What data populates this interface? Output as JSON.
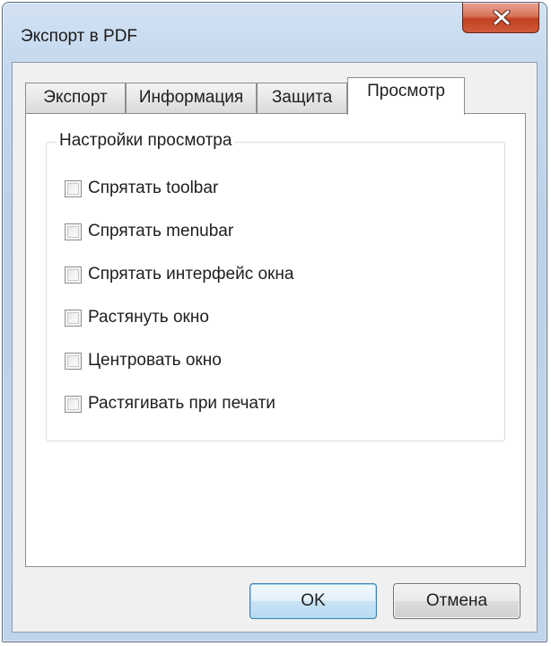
{
  "window": {
    "title": "Экспорт в PDF"
  },
  "icons": {
    "close": "close-icon"
  },
  "tabs": [
    {
      "label": "Экспорт",
      "active": false
    },
    {
      "label": "Информация",
      "active": false
    },
    {
      "label": "Защита",
      "active": false
    },
    {
      "label": "Просмотр",
      "active": true
    }
  ],
  "view_settings": {
    "group_title": "Настройки просмотра",
    "options": [
      {
        "label": "Спрятать toolbar",
        "checked": false
      },
      {
        "label": "Спрятать menubar",
        "checked": false
      },
      {
        "label": "Спрятать интерфейс окна",
        "checked": false
      },
      {
        "label": "Растянуть окно",
        "checked": false
      },
      {
        "label": "Центровать окно",
        "checked": false
      },
      {
        "label": "Растягивать при печати",
        "checked": false
      }
    ]
  },
  "buttons": {
    "ok": "OK",
    "cancel": "Отмена"
  },
  "colors": {
    "close_button": "#c9492a",
    "default_button_border": "#3c7fb1"
  }
}
